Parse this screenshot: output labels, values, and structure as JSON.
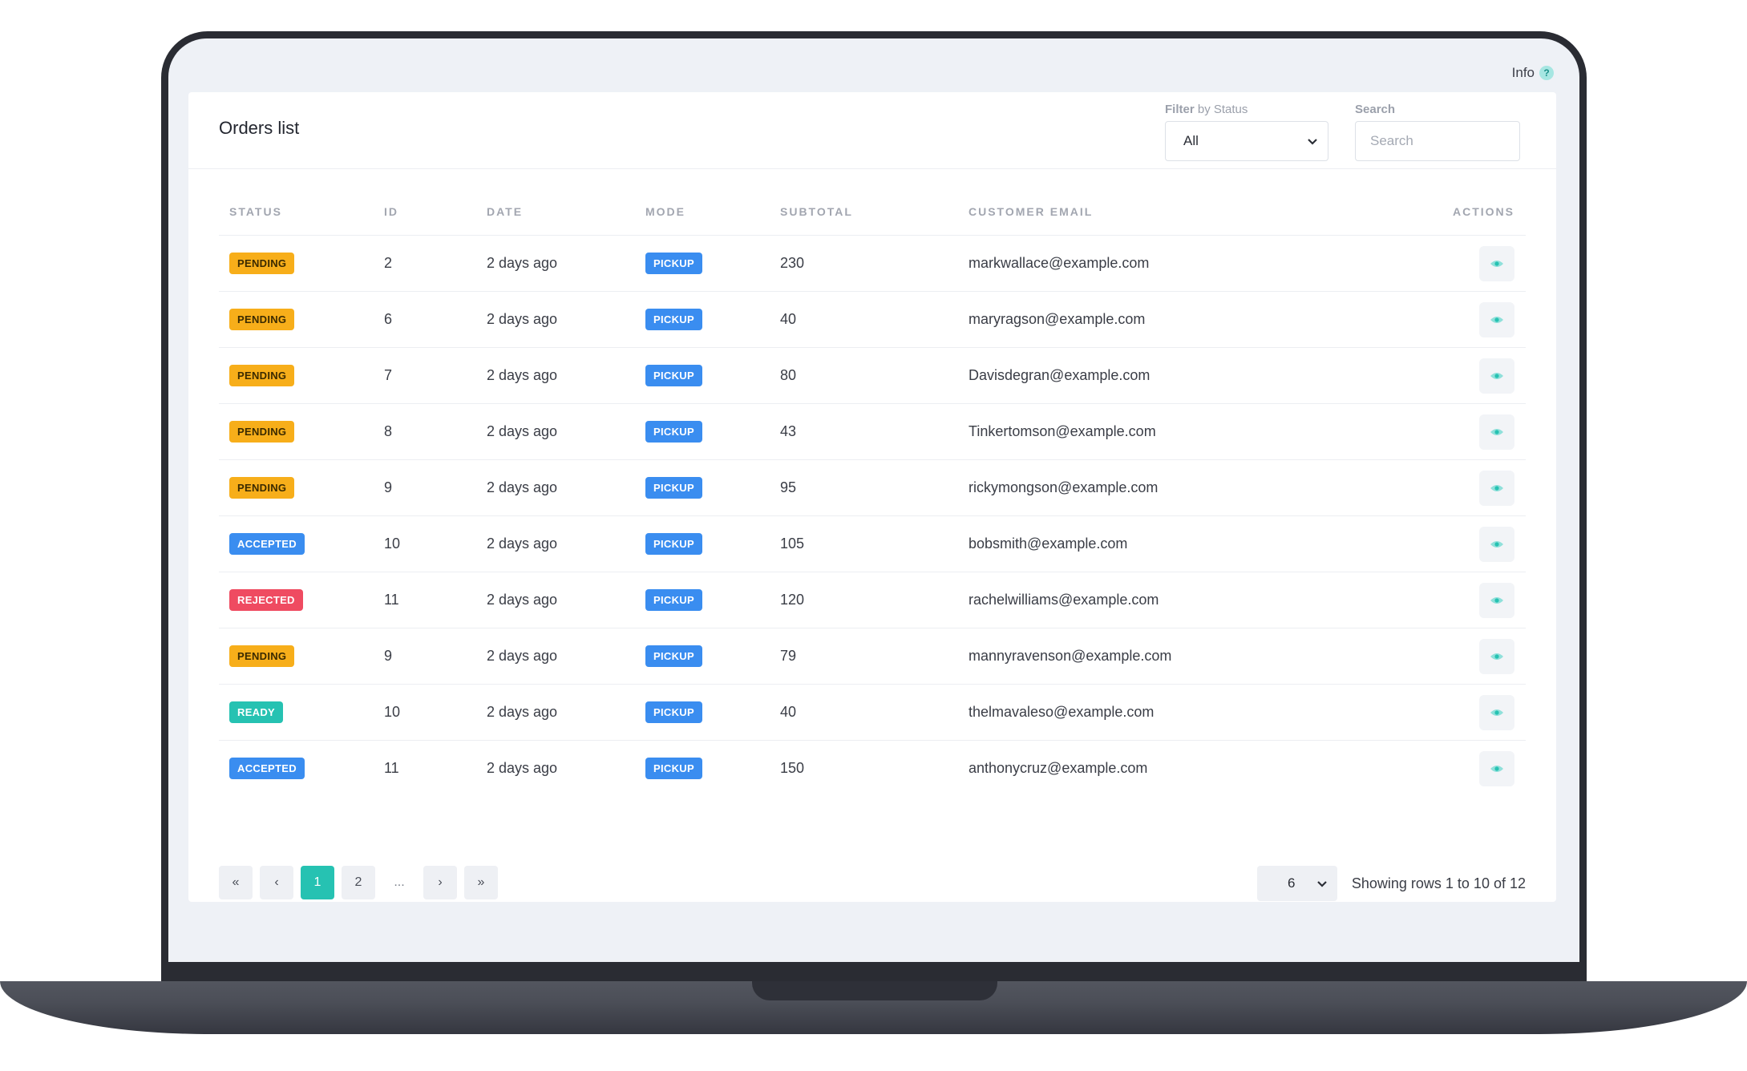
{
  "header": {
    "info_label": "Info",
    "info_icon": "question-icon"
  },
  "card": {
    "title": "Orders list",
    "filter": {
      "label_prefix": "Filter",
      "label_suffix": " by Status",
      "selected": "All"
    },
    "search": {
      "label": "Search",
      "placeholder": "Search"
    }
  },
  "table": {
    "columns": [
      "STATUS",
      "ID",
      "DATE",
      "MODE",
      "SUBTOTAL",
      "CUSTOMER EMAIL",
      "ACTIONS"
    ],
    "rows": [
      {
        "status": "PENDING",
        "id": "2",
        "date": "2 days ago",
        "mode": "PICKUP",
        "subtotal": "230",
        "email": "markwallace@example.com"
      },
      {
        "status": "PENDING",
        "id": "6",
        "date": "2 days ago",
        "mode": "PICKUP",
        "subtotal": "40",
        "email": "maryragson@example.com"
      },
      {
        "status": "PENDING",
        "id": "7",
        "date": "2 days ago",
        "mode": "PICKUP",
        "subtotal": "80",
        "email": "Davisdegran@example.com"
      },
      {
        "status": "PENDING",
        "id": "8",
        "date": "2 days ago",
        "mode": "PICKUP",
        "subtotal": "43",
        "email": "Tinkertomson@example.com"
      },
      {
        "status": "PENDING",
        "id": "9",
        "date": "2 days ago",
        "mode": "PICKUP",
        "subtotal": "95",
        "email": "rickymongson@example.com"
      },
      {
        "status": "ACCEPTED",
        "id": "10",
        "date": "2 days ago",
        "mode": "PICKUP",
        "subtotal": "105",
        "email": "bobsmith@example.com"
      },
      {
        "status": "REJECTED",
        "id": "11",
        "date": "2 days ago",
        "mode": "PICKUP",
        "subtotal": "120",
        "email": "rachelwilliams@example.com"
      },
      {
        "status": "PENDING",
        "id": "9",
        "date": "2 days ago",
        "mode": "PICKUP",
        "subtotal": "79",
        "email": "mannyravenson@example.com"
      },
      {
        "status": "READY",
        "id": "10",
        "date": "2 days ago",
        "mode": "PICKUP",
        "subtotal": "40",
        "email": "thelmavaleso@example.com"
      },
      {
        "status": "ACCEPTED",
        "id": "11",
        "date": "2 days ago",
        "mode": "PICKUP",
        "subtotal": "150",
        "email": "anthonycruz@example.com"
      }
    ]
  },
  "pagination": {
    "first": "«",
    "prev": "‹",
    "pages": [
      "1",
      "2"
    ],
    "ellipsis": "...",
    "next": "›",
    "last": "»",
    "current": "1",
    "rows_per_page": "6",
    "showing": "Showing rows 1 to 10 of 12"
  },
  "colors": {
    "pending": "#f7ae1a",
    "accepted": "#3a8df0",
    "rejected": "#ef4b61",
    "ready": "#26c2b2",
    "pickup": "#3a8df0",
    "accent": "#26c2b2"
  }
}
